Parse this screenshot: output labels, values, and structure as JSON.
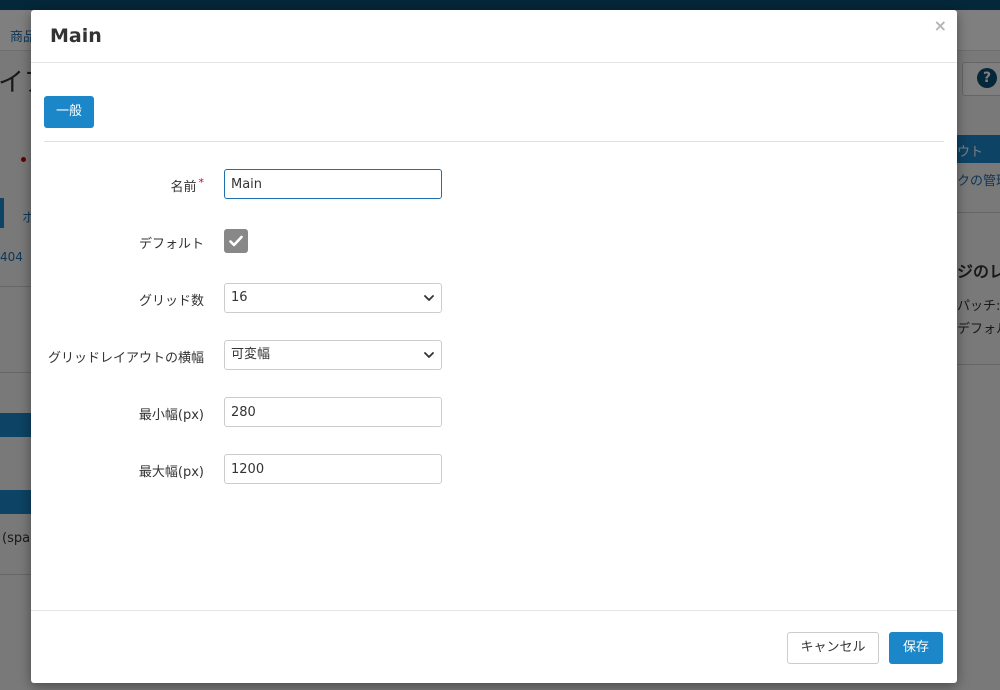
{
  "background": {
    "breadcrumb_fragment": "商品",
    "heading_fragment": "イア",
    "right_button_fragment": "ウト",
    "right_link_fragment": "クの管理",
    "right_section_heading_fragment": "ジのレイ",
    "right_text_fragment_1": "パッチ:",
    "right_text_fragment_2": "デフォル",
    "left_fragment_404": "404",
    "left_fragment_spa": "(spa",
    "left_tab_fragment": "ホ"
  },
  "modal": {
    "title": "Main",
    "close_glyph": "×",
    "tabs": [
      {
        "label": "一般"
      }
    ],
    "form": {
      "name": {
        "label": "名前",
        "required_mark": "*",
        "value": "Main"
      },
      "default": {
        "label": "デフォルト",
        "checked": true
      },
      "grid_count": {
        "label": "グリッド数",
        "selected": "16"
      },
      "grid_layout_width": {
        "label": "グリッドレイアウトの横幅",
        "selected": "可変幅"
      },
      "min_width": {
        "label": "最小幅(px)",
        "value": "280"
      },
      "max_width": {
        "label": "最大幅(px)",
        "value": "1200"
      }
    },
    "footer": {
      "cancel_label": "キャンセル",
      "save_label": "保存"
    }
  },
  "colors": {
    "primary": "#1b87c9",
    "topbar": "#0a4f74",
    "checkbox": "#888888"
  }
}
